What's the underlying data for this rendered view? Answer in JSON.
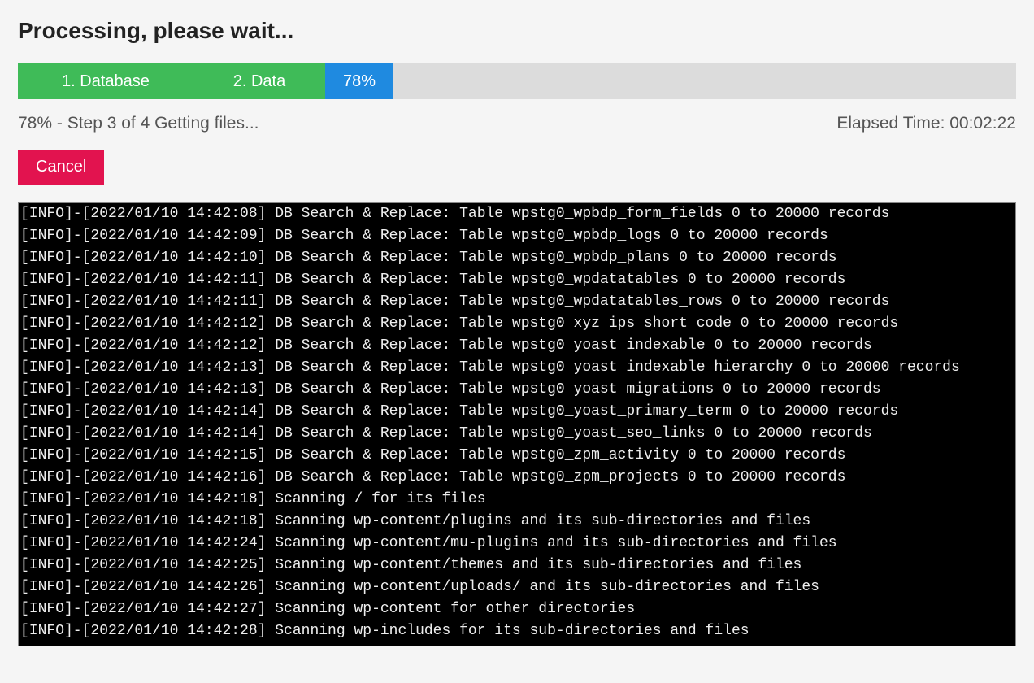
{
  "title": "Processing, please wait...",
  "progress": {
    "segment1": "1. Database",
    "segment2": "2. Data",
    "segment3": "78%"
  },
  "status_left": "78% - Step 3 of 4 Getting files...",
  "status_right": "Elapsed Time: 00:02:22",
  "cancel_label": "Cancel",
  "log_lines": [
    "[INFO]-[2022/01/10 14:42:08] DB Search & Replace: Table wpstg0_wpbdp_form_fields 0 to 20000 records",
    "[INFO]-[2022/01/10 14:42:09] DB Search & Replace: Table wpstg0_wpbdp_logs 0 to 20000 records",
    "[INFO]-[2022/01/10 14:42:10] DB Search & Replace: Table wpstg0_wpbdp_plans 0 to 20000 records",
    "[INFO]-[2022/01/10 14:42:11] DB Search & Replace: Table wpstg0_wpdatatables 0 to 20000 records",
    "[INFO]-[2022/01/10 14:42:11] DB Search & Replace: Table wpstg0_wpdatatables_rows 0 to 20000 records",
    "[INFO]-[2022/01/10 14:42:12] DB Search & Replace: Table wpstg0_xyz_ips_short_code 0 to 20000 records",
    "[INFO]-[2022/01/10 14:42:12] DB Search & Replace: Table wpstg0_yoast_indexable 0 to 20000 records",
    "[INFO]-[2022/01/10 14:42:13] DB Search & Replace: Table wpstg0_yoast_indexable_hierarchy 0 to 20000 records",
    "[INFO]-[2022/01/10 14:42:13] DB Search & Replace: Table wpstg0_yoast_migrations 0 to 20000 records",
    "[INFO]-[2022/01/10 14:42:14] DB Search & Replace: Table wpstg0_yoast_primary_term 0 to 20000 records",
    "[INFO]-[2022/01/10 14:42:14] DB Search & Replace: Table wpstg0_yoast_seo_links 0 to 20000 records",
    "[INFO]-[2022/01/10 14:42:15] DB Search & Replace: Table wpstg0_zpm_activity 0 to 20000 records",
    "[INFO]-[2022/01/10 14:42:16] DB Search & Replace: Table wpstg0_zpm_projects 0 to 20000 records",
    "[INFO]-[2022/01/10 14:42:18] Scanning / for its files",
    "[INFO]-[2022/01/10 14:42:18] Scanning wp-content/plugins and its sub-directories and files",
    "[INFO]-[2022/01/10 14:42:24] Scanning wp-content/mu-plugins and its sub-directories and files",
    "[INFO]-[2022/01/10 14:42:25] Scanning wp-content/themes and its sub-directories and files",
    "[INFO]-[2022/01/10 14:42:26] Scanning wp-content/uploads/ and its sub-directories and files",
    "[INFO]-[2022/01/10 14:42:27] Scanning wp-content for other directories",
    "[INFO]-[2022/01/10 14:42:28] Scanning wp-includes for its sub-directories and files"
  ]
}
